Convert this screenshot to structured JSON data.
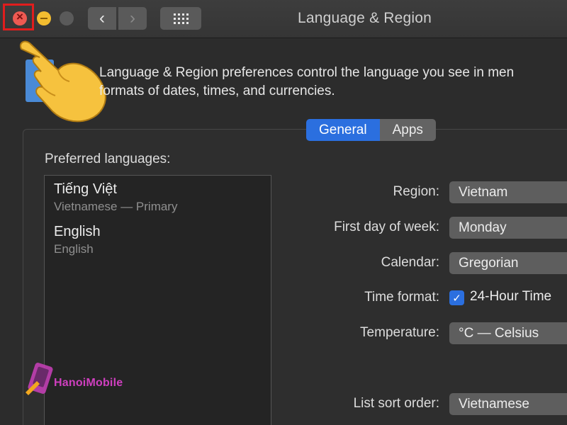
{
  "window": {
    "title": "Language & Region"
  },
  "intro_text": {
    "line1": "Language & Region preferences control the language you see in men",
    "line2": "formats of dates, times, and currencies."
  },
  "tabs": [
    {
      "label": "General",
      "active": true
    },
    {
      "label": "Apps",
      "active": false
    }
  ],
  "preferred_languages": {
    "label": "Preferred languages:",
    "items": [
      {
        "name": "Tiếng Việt",
        "detail": "Vietnamese — Primary"
      },
      {
        "name": "English",
        "detail": "English"
      }
    ]
  },
  "settings": {
    "region": {
      "label": "Region:",
      "value": "Vietnam"
    },
    "first_day": {
      "label": "First day of week:",
      "value": "Monday"
    },
    "calendar": {
      "label": "Calendar:",
      "value": "Gregorian"
    },
    "time_format": {
      "label": "Time format:",
      "value": "24-Hour Time",
      "checked": true
    },
    "temperature": {
      "label": "Temperature:",
      "value": "°C — Celsius"
    },
    "sort_order": {
      "label": "List sort order:",
      "value": "Vietnamese"
    }
  },
  "watermark": {
    "text": "HanoiMobile"
  },
  "icons": {
    "close": "close-icon",
    "minimize": "minimize-icon",
    "back": "chevron-left-icon",
    "forward": "chevron-right-icon",
    "grid": "grid-icon",
    "pointer": "pointing-hand-icon"
  },
  "colors": {
    "accent": "#2b6fdf",
    "close": "#ee5a52",
    "minimize": "#f3bd30",
    "highlight": "#e11d1d"
  }
}
